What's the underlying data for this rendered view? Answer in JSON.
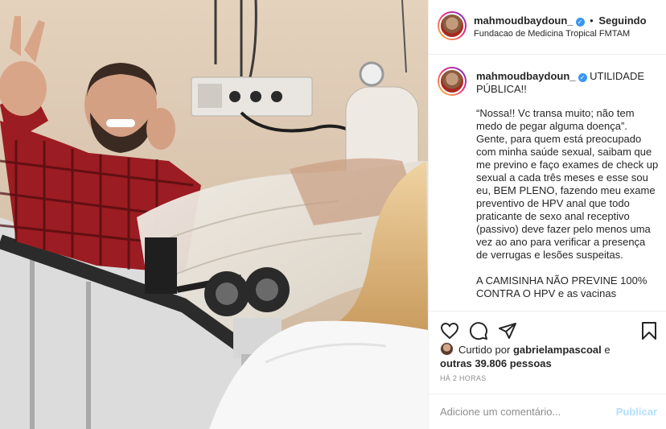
{
  "post": {
    "username": "mahmoudbaydoun_",
    "separator": "•",
    "follow_status": "Seguindo",
    "location": "Fundacao de Medicina Tropical FMTAM",
    "caption_first": "UTILIDADE PÚBLICA!!",
    "caption_paragraphs": [
      "“Nossa!! Vc transa muito; não tem medo de pegar alguma doença”. Gente, para quem está preocupado com minha saúde sexual, saibam que me previno e faço exames de check up sexual a cada três meses e esse sou eu, BEM PLENO, fazendo meu exame preventivo de HPV anal que todo praticante de sexo anal receptivo (passivo) deve fazer pelo menos uma vez ao ano para verificar a presença de verrugas e lesões suspeitas.",
      "A CAMISINHA NÃO PREVINE 100% CONTRA O HPV e as vacinas"
    ],
    "liked_prefix": "Curtido por",
    "liked_by": "gabrielampascoal",
    "liked_conj": "e",
    "liked_others": "outras 39.806 pessoas",
    "time_ago": "HÁ 2 HORAS",
    "comment_placeholder": "Adicione um comentário...",
    "publish_label": "Publicar"
  },
  "icons": {
    "like": "heart-icon",
    "comment": "comment-icon",
    "share": "share-icon",
    "save": "bookmark-icon",
    "verified": "verified-badge-icon"
  },
  "colors": {
    "link_blue": "#3897f0",
    "publish_disabled": "#b2dffc",
    "muted": "#8e8e8e"
  }
}
